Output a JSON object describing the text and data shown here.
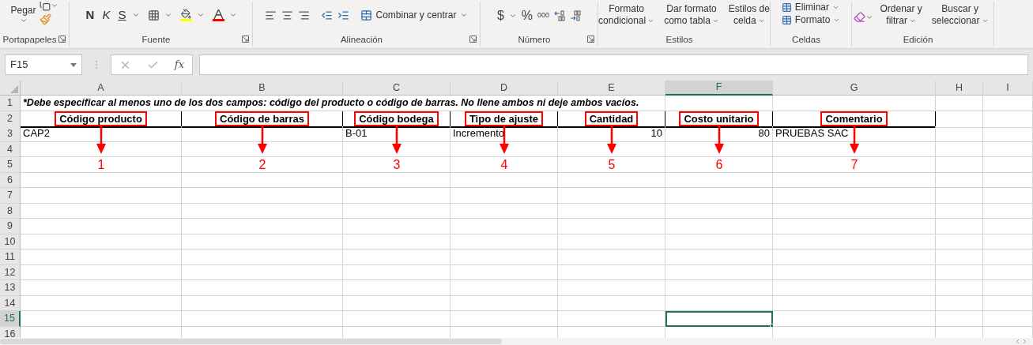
{
  "ribbon": {
    "clipboard": {
      "label": "Portapapeles",
      "launcher": true,
      "paste": "Pegar"
    },
    "font": {
      "label": "Fuente",
      "launcher": true,
      "bold": "N",
      "italic": "K",
      "underline": "S"
    },
    "alignment": {
      "label": "Alineación",
      "launcher": true,
      "merge": "Combinar y centrar"
    },
    "number": {
      "label": "Número",
      "launcher": true,
      "currency": "$",
      "percent": "%",
      "thousands": "000"
    },
    "styles": {
      "label": "Estilos",
      "launcher": false,
      "buttons": [
        {
          "lines": [
            "Formato",
            "condicional"
          ]
        },
        {
          "lines": [
            "Dar formato",
            "como tabla"
          ]
        },
        {
          "lines": [
            "Estilos de",
            "celda"
          ]
        }
      ]
    },
    "cells": {
      "label": "Celdas",
      "launcher": false,
      "delete": "Eliminar",
      "format": "Formato"
    },
    "editing": {
      "label": "Edición",
      "launcher": false,
      "buttons": [
        {
          "lines": [
            "Ordenar y",
            "filtrar"
          ]
        },
        {
          "lines": [
            "Buscar y",
            "seleccionar"
          ]
        }
      ]
    }
  },
  "formula_bar": {
    "name_box": "F15",
    "fx": "fx"
  },
  "sheet": {
    "columns": [
      {
        "label": "A",
        "selected": false
      },
      {
        "label": "B",
        "selected": false
      },
      {
        "label": "C",
        "selected": false
      },
      {
        "label": "D",
        "selected": false
      },
      {
        "label": "E",
        "selected": false
      },
      {
        "label": "F",
        "selected": true
      },
      {
        "label": "G",
        "selected": false
      },
      {
        "label": "H",
        "selected": false
      },
      {
        "label": "I",
        "selected": false
      }
    ],
    "rows": [
      {
        "label": "1",
        "selected": false
      },
      {
        "label": "2",
        "selected": false
      },
      {
        "label": "3",
        "selected": false
      },
      {
        "label": "4",
        "selected": false
      },
      {
        "label": "5",
        "selected": false
      },
      {
        "label": "6",
        "selected": false
      },
      {
        "label": "7",
        "selected": false
      },
      {
        "label": "8",
        "selected": false
      },
      {
        "label": "9",
        "selected": false
      },
      {
        "label": "10",
        "selected": false
      },
      {
        "label": "11",
        "selected": false
      },
      {
        "label": "12",
        "selected": false
      },
      {
        "label": "13",
        "selected": false
      },
      {
        "label": "14",
        "selected": false
      },
      {
        "label": "15",
        "selected": true
      },
      {
        "label": "16",
        "selected": false
      }
    ],
    "note": "*Debe especificar al menos uno de los dos campos: código del producto o código de barras. No llene ambos ni deje ambos vacíos.",
    "headers": [
      "Código producto",
      "Código de barras",
      "Código bodega",
      "Tipo de ajuste",
      "Cantidad",
      "Costo unitario",
      "Comentario"
    ],
    "record": [
      {
        "kind": "text",
        "text": "CAP2"
      },
      {
        "kind": "empty"
      },
      {
        "kind": "text",
        "text": "B-01"
      },
      {
        "kind": "text",
        "text": "Incremento"
      },
      {
        "kind": "number",
        "text": "10"
      },
      {
        "kind": "number",
        "text": "80"
      },
      {
        "kind": "text",
        "text": "PRUEBAS SAC"
      }
    ],
    "callouts": [
      "1",
      "2",
      "3",
      "4",
      "5",
      "6",
      "7"
    ]
  }
}
